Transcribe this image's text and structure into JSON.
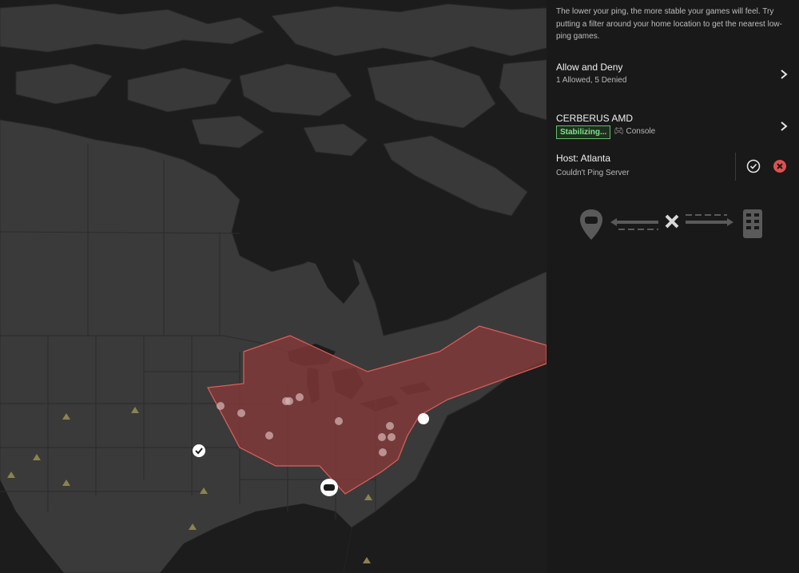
{
  "panel": {
    "intro": "The lower your ping, the more stable your games will feel. Try putting a filter around your home location to get the nearest low-ping games.",
    "allow_deny": {
      "title": "Allow and Deny",
      "subtitle": "1 Allowed, 5 Denied"
    },
    "router": {
      "title": "CERBERUS AMD",
      "status": "Stabilizing...",
      "device": "Console"
    },
    "host": {
      "title": "Host: Atlanta",
      "status": "Couldn't Ping Server"
    }
  },
  "colors": {
    "panel_bg": "#191919",
    "map_land": "#3a3a3a",
    "map_water": "#1c1c1c",
    "filter_fill": "#8a3a3a",
    "filter_stroke": "#e0605a",
    "status_green": "#7ee38a",
    "deny_red": "#e05050"
  },
  "icons": [
    "chevron-right-icon",
    "gamepad-icon",
    "check-circle-icon",
    "x-circle-icon",
    "location-gamepad-icon",
    "server-icon",
    "checkmark-marker-icon",
    "triangle-marker-icon"
  ]
}
